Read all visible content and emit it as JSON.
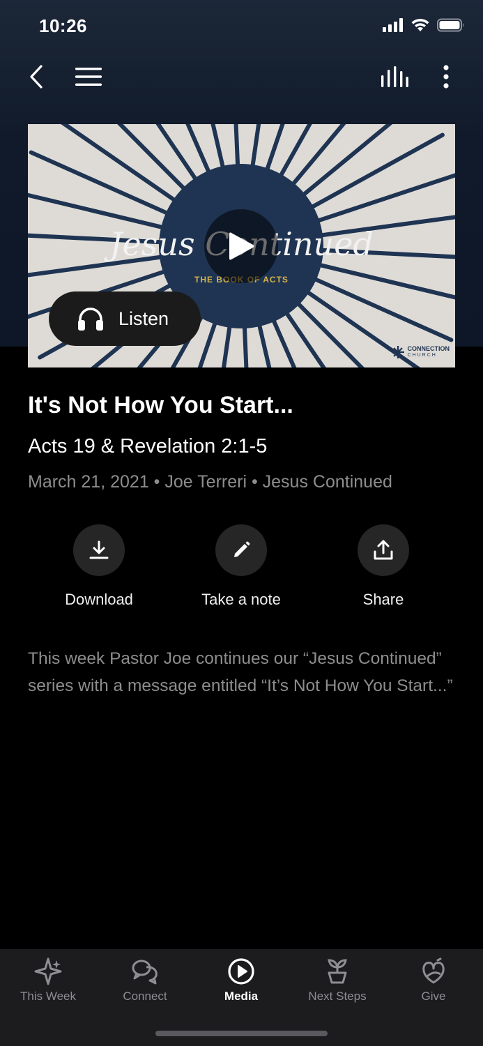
{
  "status_bar": {
    "time": "10:26"
  },
  "nav": {
    "back_icon": "chevron-left-icon",
    "menu_icon": "hamburger-menu-icon",
    "audio_icon": "audio-bars-icon",
    "more_icon": "more-vertical-icon"
  },
  "artwork": {
    "title": "Jesus Continued",
    "subtitle": "THE BOOK OF ACTS",
    "logo_line1": "CONNECTION",
    "logo_line2": "CHURCH",
    "background_color": "#dedbd6",
    "ray_color": "#1f3452"
  },
  "listen_button": {
    "label": "Listen",
    "icon": "headphones-icon"
  },
  "sermon": {
    "title": "It's Not How You Start...",
    "scripture": "Acts 19 & Revelation 2:1-5",
    "meta": "March 21, 2021 • Joe Terreri • Jesus Continued",
    "description": "This week Pastor Joe continues our “Jesus Continued” series with a message entitled “It’s Not How You Start...”"
  },
  "actions": [
    {
      "label": "Download",
      "icon": "download-icon"
    },
    {
      "label": "Take a note",
      "icon": "pencil-icon"
    },
    {
      "label": "Share",
      "icon": "share-icon"
    }
  ],
  "tabs": [
    {
      "label": "This Week",
      "icon": "sparkle-icon",
      "active": false
    },
    {
      "label": "Connect",
      "icon": "chat-bubbles-icon",
      "active": false
    },
    {
      "label": "Media",
      "icon": "play-circle-icon",
      "active": true
    },
    {
      "label": "Next Steps",
      "icon": "sprout-icon",
      "active": false
    },
    {
      "label": "Give",
      "icon": "give-icon",
      "active": false
    }
  ],
  "colors": {
    "background": "#000000",
    "header": "#101a2a",
    "tab_bar": "#1c1c1e",
    "muted_text": "#8d8d8d"
  }
}
